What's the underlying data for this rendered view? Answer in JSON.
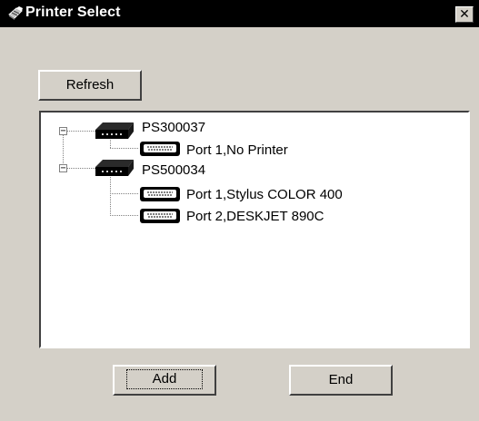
{
  "window": {
    "title": "Printer Select",
    "title_icon": "printer-select-icon",
    "close_glyph": "✕"
  },
  "toolbar": {
    "refresh_label": "Refresh"
  },
  "tree": {
    "servers": [
      {
        "name": "PS300037",
        "expanded": true,
        "ports": [
          {
            "label": "Port 1,No Printer"
          }
        ]
      },
      {
        "name": "PS500034",
        "expanded": true,
        "ports": [
          {
            "label": "Port 1,Stylus COLOR 400"
          },
          {
            "label": "Port 2,DESKJET 890C"
          }
        ]
      }
    ]
  },
  "footer": {
    "add_label": "Add",
    "end_label": "End"
  },
  "colors": {
    "titlebar": "#000000",
    "dialog_bg": "#d4d0c8",
    "tree_bg": "#ffffff"
  }
}
